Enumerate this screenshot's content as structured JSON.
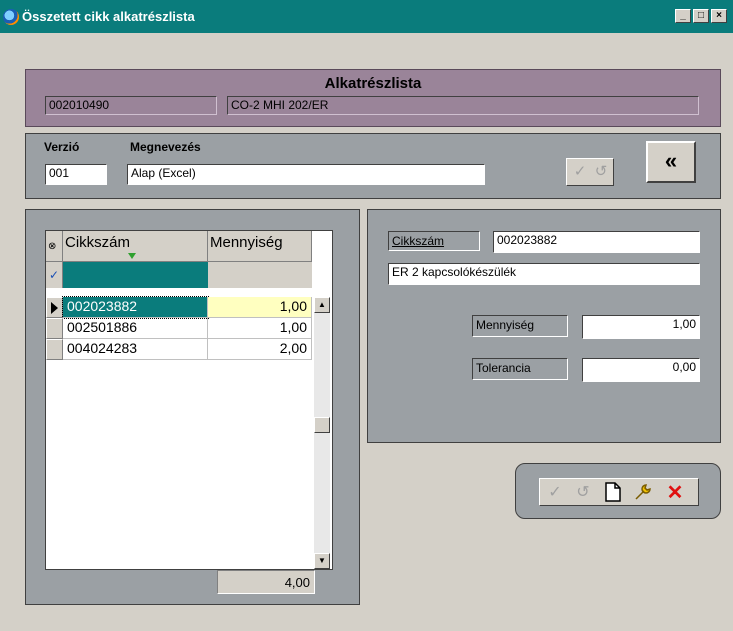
{
  "window": {
    "title": "Összetett cikk alkatrészlista",
    "controls": {
      "minimize": "_",
      "maximize": "□",
      "close": "×"
    }
  },
  "header": {
    "title": "Alkatrészlista",
    "code": "002010490",
    "name": "CO-2 MHI 202/ER"
  },
  "version": {
    "label_version": "Verzió",
    "label_name": "Megnevezés",
    "version_value": "001",
    "name_value": "Alap (Excel)",
    "back_button": "«"
  },
  "grid": {
    "columns": [
      "Cikkszám",
      "Mennyiség"
    ],
    "rows": [
      {
        "code": "002023882",
        "qty": "1,00"
      },
      {
        "code": "002501886",
        "qty": "1,00"
      },
      {
        "code": "004024283",
        "qty": "2,00"
      }
    ],
    "total": "4,00"
  },
  "detail": {
    "label_code": "Cikkszám",
    "code_value": "002023882",
    "description": "ER 2 kapcsolókészülék",
    "label_qty": "Mennyiség",
    "qty_value": "1,00",
    "label_tolerance": "Tolerancia",
    "tolerance_value": "0,00"
  },
  "icons": {
    "confirm": "check-icon",
    "undo": "undo-icon",
    "new": "new-document-icon",
    "edit": "wrench-icon",
    "delete": "delete-icon"
  }
}
